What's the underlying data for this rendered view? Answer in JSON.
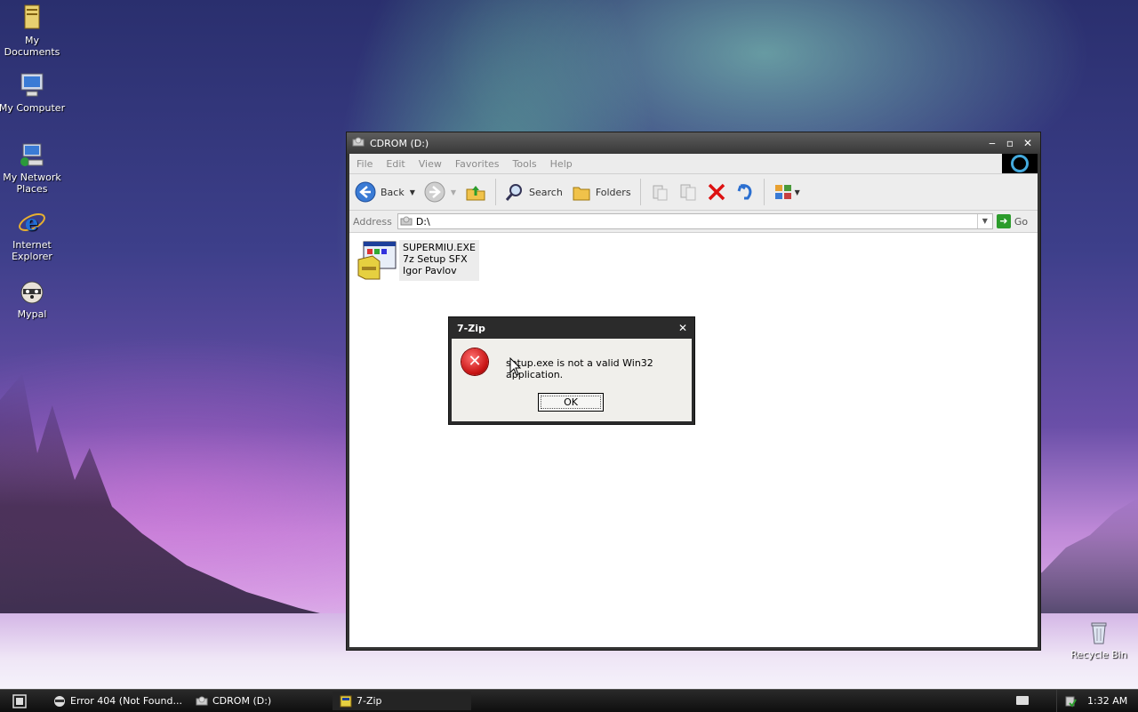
{
  "desktop": {
    "icons": [
      {
        "label": "My Documents"
      },
      {
        "label": "My Computer"
      },
      {
        "label": "My Network Places"
      },
      {
        "label": "Internet Explorer"
      },
      {
        "label": "Mypal"
      },
      {
        "label": "Recycle Bin"
      }
    ]
  },
  "explorer": {
    "title": "CDROM (D:)",
    "menu": [
      "File",
      "Edit",
      "View",
      "Favorites",
      "Tools",
      "Help"
    ],
    "toolbar": {
      "back_label": "Back",
      "search_label": "Search",
      "folders_label": "Folders"
    },
    "address": {
      "label": "Address",
      "value": "D:\\",
      "go_label": "Go"
    },
    "file": {
      "name": "SUPERMIU.EXE",
      "description": "7z Setup SFX",
      "company": "Igor Pavlov"
    }
  },
  "dialog": {
    "title": "7-Zip",
    "message": "setup.exe is not a valid Win32 application.",
    "ok_label": "OK"
  },
  "taskbar": {
    "tasks": [
      {
        "label": "Error 404 (Not Found..."
      },
      {
        "label": "CDROM (D:)"
      },
      {
        "label": "7-Zip"
      }
    ],
    "clock": "1:32 AM"
  },
  "colors": {
    "error_red": "#c81414",
    "go_green": "#2c9c2c",
    "window_frame": "#383838"
  }
}
